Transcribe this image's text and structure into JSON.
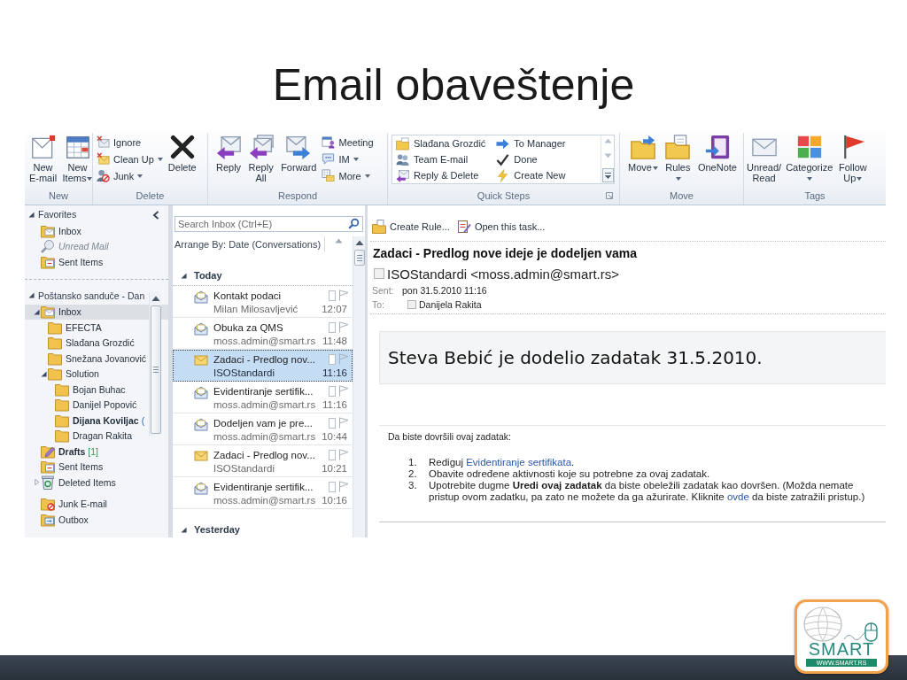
{
  "slide": {
    "title": "Email obaveštenje"
  },
  "ribbon": {
    "groups": [
      {
        "label": "New",
        "kind": "buttons",
        "columns": [
          {
            "kind": "large",
            "buttons": [
              {
                "label": "New E-mail",
                "kind": "compose",
                "dropdown": false
              }
            ]
          },
          {
            "kind": "large",
            "buttons": [
              {
                "label": "New Items",
                "kind": "calendar",
                "dropdown": true
              }
            ]
          }
        ]
      },
      {
        "label": "Delete",
        "kind": "buttons",
        "columns": [
          {
            "kind": "stack",
            "buttons": [
              {
                "label": "Ignore",
                "kind": "ignore",
                "dropdown": false
              },
              {
                "label": "Clean Up",
                "kind": "cleanup",
                "dropdown": true
              },
              {
                "label": "Junk",
                "kind": "junk",
                "dropdown": true
              }
            ]
          },
          {
            "kind": "large",
            "buttons": [
              {
                "label": "Delete",
                "kind": "delete",
                "dropdown": false
              }
            ]
          }
        ]
      },
      {
        "label": "Respond",
        "kind": "buttons",
        "columns": [
          {
            "kind": "large",
            "buttons": [
              {
                "label": "Reply",
                "kind": "reply",
                "dropdown": false
              }
            ]
          },
          {
            "kind": "large",
            "buttons": [
              {
                "label": "Reply All",
                "kind": "replyall",
                "dropdown": false
              }
            ]
          },
          {
            "kind": "large",
            "buttons": [
              {
                "label": "Forward",
                "kind": "forward",
                "dropdown": false
              }
            ]
          },
          {
            "kind": "stack",
            "buttons": [
              {
                "label": "Meeting",
                "kind": "meeting",
                "dropdown": false
              },
              {
                "label": "IM",
                "kind": "im",
                "dropdown": true
              },
              {
                "label": "More",
                "kind": "more",
                "dropdown": true
              }
            ]
          }
        ]
      },
      {
        "label": "Quick Steps",
        "kind": "gallery",
        "items": [
          {
            "label": "Slađana Grozdić",
            "kind": "movefolder"
          },
          {
            "label": "Team E-mail",
            "kind": "team"
          },
          {
            "label": "Reply & Delete",
            "kind": "replydelete"
          },
          {
            "label": "To Manager",
            "kind": "tomanager"
          },
          {
            "label": "Done",
            "kind": "done"
          },
          {
            "label": "Create New",
            "kind": "createnew"
          }
        ]
      },
      {
        "label": "Move",
        "kind": "buttons",
        "columns": [
          {
            "kind": "large",
            "buttons": [
              {
                "label": "Move",
                "kind": "move",
                "dropdown": true
              }
            ]
          },
          {
            "kind": "large",
            "buttons": [
              {
                "label": "Rules",
                "kind": "rules",
                "dropdown": true
              }
            ]
          },
          {
            "kind": "large",
            "buttons": [
              {
                "label": "OneNote",
                "kind": "onenote",
                "dropdown": false
              }
            ]
          }
        ]
      },
      {
        "label": "Tags",
        "kind": "buttons",
        "columns": [
          {
            "kind": "large",
            "buttons": [
              {
                "label": "Unread/ Read",
                "kind": "unread",
                "dropdown": false
              }
            ]
          },
          {
            "kind": "large",
            "buttons": [
              {
                "label": "Categorize",
                "kind": "categorize",
                "dropdown": true
              }
            ]
          },
          {
            "kind": "large",
            "buttons": [
              {
                "label": "Follow Up",
                "kind": "flag",
                "dropdown": true
              }
            ]
          }
        ]
      }
    ]
  },
  "navigation": {
    "sections": [
      {
        "label": "Favorites",
        "expanded": true,
        "folders": [
          {
            "label": "Inbox",
            "kind": "inbox",
            "selected": false,
            "unread": false
          },
          {
            "label": "Unread Mail",
            "kind": "search",
            "selected": false,
            "unread": false
          },
          {
            "label": "Sent Items",
            "kind": "sent",
            "selected": false,
            "unread": false
          }
        ]
      },
      {
        "label": "Poštansko sanduče - Dan",
        "expanded": true,
        "folders": [
          {
            "label": "Inbox",
            "kind": "inbox",
            "selected": true,
            "unread": false,
            "expanded": true,
            "children": [
              {
                "label": "EFECTA",
                "kind": "folder",
                "selected": false,
                "unread": false
              },
              {
                "label": "Slađana Grozdić",
                "kind": "folder",
                "selected": false,
                "unread": false
              },
              {
                "label": "Snežana Jovanović",
                "kind": "folder",
                "selected": false,
                "unread": false
              },
              {
                "label": "Solution",
                "kind": "folder",
                "selected": false,
                "unread": false,
                "expanded": true,
                "children": [
                  {
                    "label": "Bojan Buhac",
                    "kind": "folder",
                    "selected": false,
                    "unread": false
                  },
                  {
                    "label": "Danijel Popović",
                    "kind": "folder",
                    "selected": false,
                    "unread": false
                  },
                  {
                    "label": "Dijana Koviljac",
                    "kind": "folder",
                    "selected": false,
                    "unread": true,
                    "count": "("
                  },
                  {
                    "label": "Dragan Rakita",
                    "kind": "folder",
                    "selected": false,
                    "unread": false
                  }
                ]
              }
            ]
          },
          {
            "label": "Drafts",
            "kind": "drafts",
            "selected": false,
            "unread": true,
            "count": "[1]"
          },
          {
            "label": "Sent Items",
            "kind": "sent",
            "selected": false,
            "unread": false
          },
          {
            "label": "Deleted Items",
            "kind": "deleted",
            "selected": false,
            "unread": false,
            "expanded": false
          },
          {
            "label": "Junk E-mail",
            "kind": "junk",
            "selected": false,
            "unread": false
          },
          {
            "label": "Outbox",
            "kind": "outbox",
            "selected": false,
            "unread": false
          }
        ]
      }
    ]
  },
  "message_list": {
    "search": {
      "placeholder": "Search Inbox (Ctrl+E)"
    },
    "arrange_by": "Arrange By: Date (Conversations)",
    "groups": [
      {
        "label": "Today",
        "expanded": true,
        "messages": [
          {
            "subject": "Kontakt podaci",
            "sender": "Milan Milosavljević",
            "time": "12:07",
            "kind": "read",
            "selected": false
          },
          {
            "subject": "Obuka za QMS",
            "sender": "moss.admin@smart.rs",
            "time": "11:48",
            "kind": "read",
            "selected": false
          },
          {
            "subject": "Zadaci - Predlog nov...",
            "sender": "ISOStandardi",
            "time": "11:16",
            "kind": "task",
            "selected": true
          },
          {
            "subject": "Evidentiranje sertifik...",
            "sender": "moss.admin@smart.rs",
            "time": "11:16",
            "kind": "read",
            "selected": false
          },
          {
            "subject": "Dodeljen vam je pre...",
            "sender": "moss.admin@smart.rs",
            "time": "10:44",
            "kind": "read",
            "selected": false
          },
          {
            "subject": "Zadaci - Predlog nov...",
            "sender": "ISOStandardi",
            "time": "10:21",
            "kind": "task",
            "selected": false
          },
          {
            "subject": "Evidentiranje sertifik...",
            "sender": "moss.admin@smart.rs",
            "time": "10:16",
            "kind": "read",
            "selected": false
          }
        ]
      },
      {
        "label": "Yesterday",
        "expanded": true
      }
    ]
  },
  "reading_pane": {
    "actions": [
      {
        "label": "Create Rule...",
        "kind": "rule"
      },
      {
        "label": "Open this task...",
        "kind": "task"
      }
    ],
    "subject": "Zadaci - Predlog nove ideje je dodeljen vama",
    "from": "ISOStandardi <moss.admin@smart.rs>",
    "fields": [
      {
        "label": "Sent:",
        "value": "pon 31.5.2010 11:16",
        "kind": "text"
      },
      {
        "label": "To:",
        "value": "Danijela Rakita",
        "kind": "contact"
      }
    ],
    "banner": "Steva Bebić je dodelio zadatak 31.5.2010.",
    "intro": "Da biste dovršili ovaj zadatak:",
    "steps": [
      {
        "number": "1.",
        "parts": [
          {
            "kind": "text",
            "text": "Rediguj "
          },
          {
            "kind": "link",
            "text": "Evidentiranje sertifikata"
          },
          {
            "kind": "text",
            "text": "."
          }
        ]
      },
      {
        "number": "2.",
        "parts": [
          {
            "kind": "text",
            "text": "Obavite određene aktivnosti koje su potrebne za ovaj zadatak."
          }
        ]
      },
      {
        "number": "3.",
        "parts": [
          {
            "kind": "text",
            "text": "Upotrebite dugme **Uredi ovaj zadatak** da biste obeležili zadatak kao dovršen. (Možda nemate pristup ovom zadatku, pa zato ne možete da ga ažurirate. Kliknite "
          },
          {
            "kind": "link",
            "text": "ovde"
          },
          {
            "kind": "text",
            "text": " da biste zatražili pristup.)"
          }
        ]
      }
    ]
  },
  "logo": {
    "name": "SMART",
    "url": "WWW.SMART.RS"
  }
}
